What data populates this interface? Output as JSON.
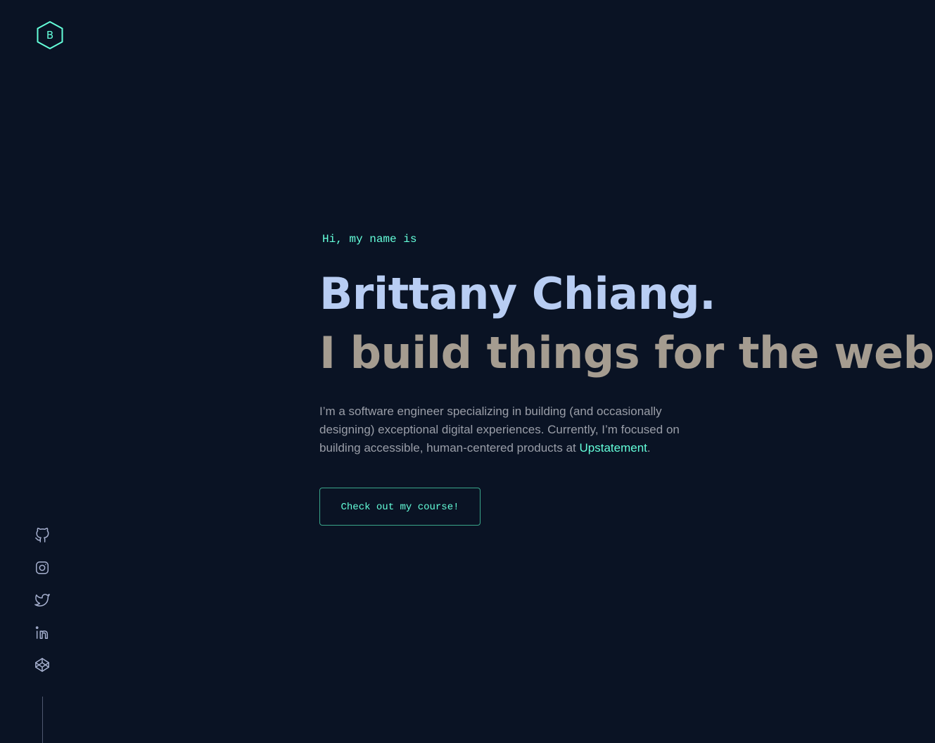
{
  "logo": {
    "letter": "B",
    "icon": "hexagon-logo-icon"
  },
  "hero": {
    "greeting": "Hi, my name is",
    "name": "Brittany Chiang.",
    "tagline": "I build things for the web.",
    "bio_text": "I’m a software engineer specializing in building (and occasionally designing) exceptional digital experiences. Currently, I’m focused on building accessible, human-centered products at ",
    "bio_link": "Upstatement",
    "bio_end": ".",
    "cta_label": "Check out my course!"
  },
  "social": [
    {
      "icon": "github-icon"
    },
    {
      "icon": "instagram-icon"
    },
    {
      "icon": "twitter-icon"
    },
    {
      "icon": "linkedin-icon"
    },
    {
      "icon": "codepen-icon"
    }
  ],
  "colors": {
    "background": "#0a1324",
    "accent": "#64ffda",
    "name": "#b8cdf3",
    "tagline": "#a59c90",
    "body_text": "#9a9ea8",
    "icon": "#a8b2d1"
  }
}
